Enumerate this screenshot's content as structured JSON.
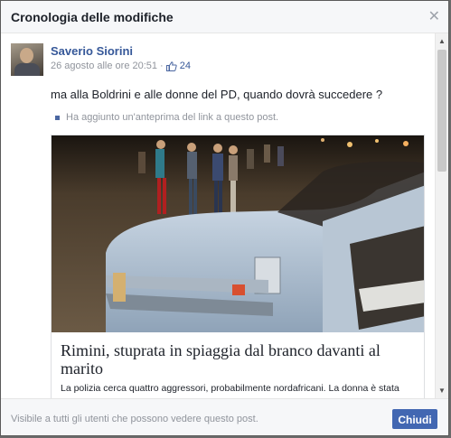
{
  "dialog": {
    "title": "Cronologia delle modifiche",
    "close_icon": "close-icon"
  },
  "post": {
    "author": "Saverio Siorini",
    "timestamp": "26 agosto alle ore 20:51",
    "separator": "·",
    "like_count": "24",
    "text": "ma alla Boldrini e alle donne del PD, quando dovrà succedere ?",
    "note": "Ha aggiunto un'anteprima del link a questo post."
  },
  "link_card": {
    "title": "Rimini, stuprata in spiaggia dal branco davanti al marito",
    "description": "La polizia cerca quattro aggressori, probabilmente nordafricani. La donna è stata"
  },
  "footer": {
    "visibility_text": "Visibile a tutti gli utenti che possono vedere questo post.",
    "close_button": "Chiudi"
  },
  "colors": {
    "link_blue": "#365899",
    "button_blue": "#4267b2",
    "muted_gray": "#90949c"
  }
}
